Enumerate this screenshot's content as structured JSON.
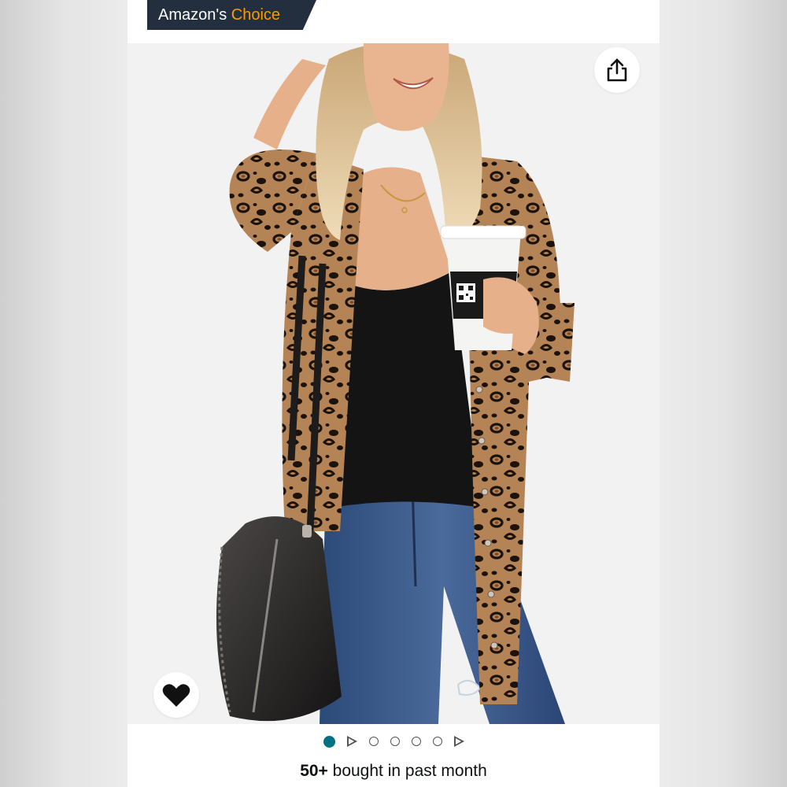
{
  "badge": {
    "prefix": "Amazon's",
    "highlight": "Choice",
    "background": "#232f3e",
    "accent_color": "#ff9900"
  },
  "product_image": {
    "alt": "Woman in leopard print cardigan with black tank top, blue jeans, black shoulder bag and coffee cup"
  },
  "actions": {
    "share_icon": "share-icon",
    "wishlist_icon": "heart-icon"
  },
  "carousel": {
    "indicators": [
      {
        "type": "dot",
        "active": true
      },
      {
        "type": "video"
      },
      {
        "type": "dot",
        "active": false
      },
      {
        "type": "dot",
        "active": false
      },
      {
        "type": "dot",
        "active": false
      },
      {
        "type": "dot",
        "active": false
      },
      {
        "type": "video"
      }
    ],
    "active_color": "#007185"
  },
  "sales": {
    "count": "50+",
    "text": " bought in past month"
  }
}
